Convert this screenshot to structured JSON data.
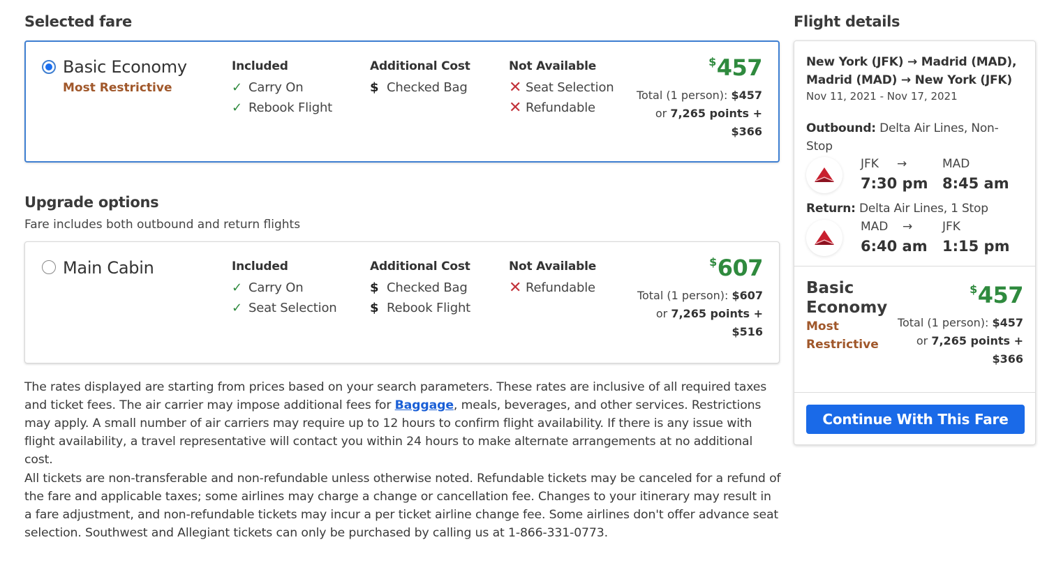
{
  "selected_fare": {
    "section_title": "Selected fare",
    "name": "Basic Economy",
    "subtitle": "Most Restrictive",
    "selected": true,
    "included_head": "Included",
    "included": [
      "Carry On",
      "Rebook Flight"
    ],
    "additional_head": "Additional Cost",
    "additional": [
      "Checked Bag"
    ],
    "not_available_head": "Not Available",
    "not_available": [
      "Seat Selection",
      "Refundable"
    ],
    "price_currency": "$",
    "price": "457",
    "total_label": "Total (1 person):",
    "total_value": "$457",
    "or_label": "or",
    "points": "7,265 points +",
    "points_cash": "$366"
  },
  "upgrade": {
    "section_title": "Upgrade options",
    "subtitle": "Fare includes both outbound and return flights",
    "options": [
      {
        "name": "Main Cabin",
        "selected": false,
        "included_head": "Included",
        "included": [
          "Carry On",
          "Seat Selection"
        ],
        "additional_head": "Additional Cost",
        "additional": [
          "Checked Bag",
          "Rebook Flight"
        ],
        "not_available_head": "Not Available",
        "not_available": [
          "Refundable"
        ],
        "price_currency": "$",
        "price": "607",
        "total_label": "Total (1 person):",
        "total_value": "$607",
        "or_label": "or",
        "points": "7,265 points +",
        "points_cash": "$516"
      }
    ]
  },
  "disclaimer": {
    "p1_before": "The rates displayed are starting from prices based on your search parameters. These rates are inclusive of all required taxes and ticket fees. The air carrier may impose additional fees for ",
    "p1_link": "Baggage",
    "p1_after": ", meals, beverages, and other services. Restrictions may apply. A small number of air carriers may require up to 12 hours to confirm flight availability. If there is any issue with flight availability, a travel representative will contact you within 24 hours to make alternate arrangements at no additional cost.",
    "p2": "All tickets are non-transferable and non-refundable unless otherwise noted. Refundable tickets may be canceled for a refund of the fare and applicable taxes; some airlines may charge a change or cancellation fee. Changes to your itinerary may result in a fare adjustment, and non-refundable tickets may incur a per ticket airline change fee. Some airlines don't offer advance seat selection. Southwest and Allegiant tickets can only be purchased by calling us at 1-866-331-0773."
  },
  "flight_details": {
    "section_title": "Flight details",
    "route_line1_from": "New York (JFK)",
    "route_line1_to": "Madrid (MAD),",
    "route_line2_from": "Madrid (MAD)",
    "route_line2_to": "New York (JFK)",
    "arrow": "→",
    "dates": "Nov 11, 2021 - Nov 17, 2021",
    "outbound": {
      "label": "Outbound:",
      "carrier": "Delta Air Lines, Non-Stop",
      "from": "JFK",
      "to": "MAD",
      "depart": "7:30 pm",
      "arrive": "8:45 am"
    },
    "return": {
      "label": "Return:",
      "carrier": "Delta Air Lines, 1 Stop",
      "from": "MAD",
      "to": "JFK",
      "depart": "6:40 am",
      "arrive": "1:15 pm"
    },
    "leg_arrow": "→",
    "summary": {
      "name": "Basic Economy",
      "subtitle": "Most Restrictive",
      "price_currency": "$",
      "price": "457",
      "total_label": "Total (1 person):",
      "total_value": "$457",
      "or_label": "or",
      "points": "7,265 points +",
      "points_cash": "$366"
    },
    "continue_label": "Continue With This Fare",
    "airline_logo": "delta-logo-icon"
  },
  "colors": {
    "accent_blue": "#1a6ae8",
    "price_green": "#2f8a3e",
    "restrictive_brown": "#a0572a",
    "cross_red": "#c2323a"
  }
}
